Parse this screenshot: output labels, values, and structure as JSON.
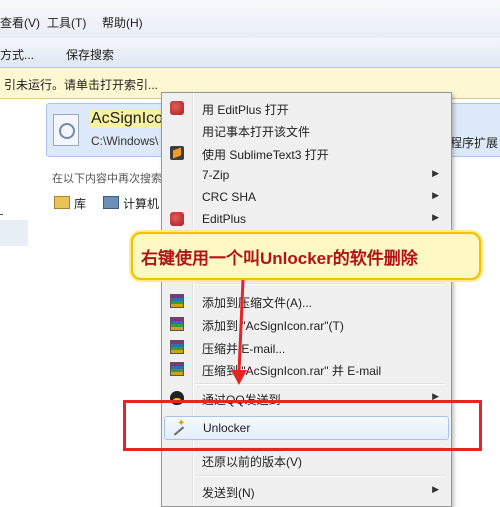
{
  "menubar": {
    "items": [
      "查看(V)",
      "工具(T)",
      "帮助(H)"
    ]
  },
  "toolbar": {
    "items": [
      "方式...",
      "保存搜索"
    ]
  },
  "infobar": {
    "text": "引未运行。请单击打开索引..."
  },
  "search_result": {
    "name": "AcSignIcon",
    "path": "C:\\Windows\\",
    "extra": "程序扩展"
  },
  "search_again": {
    "label": "在以下内容中再次搜索:",
    "locations": [
      "库",
      "计算机"
    ]
  },
  "context_menu": {
    "items": [
      {
        "label": "用 EditPlus 打开",
        "icon": "editplus-icon",
        "submenu": false
      },
      {
        "label": "用记事本打开该文件",
        "icon": "",
        "submenu": false
      },
      {
        "label": "使用 SublimeText3 打开",
        "icon": "sublime-icon",
        "submenu": false
      },
      {
        "label": "7-Zip",
        "icon": "",
        "submenu": true
      },
      {
        "label": "CRC SHA",
        "icon": "",
        "submenu": true
      },
      {
        "label": "EditPlus",
        "icon": "editplus-icon",
        "submenu": true
      },
      {
        "label": "添加到压缩文件(A)...",
        "icon": "winrar-icon",
        "submenu": false
      },
      {
        "label": "添加到 \"AcSignIcon.rar\"(T)",
        "icon": "winrar-icon",
        "submenu": false
      },
      {
        "label": "压缩并 E-mail...",
        "icon": "winrar-icon",
        "submenu": false
      },
      {
        "label": "压缩到 \"AcSignIcon.rar\" 并 E-mail",
        "icon": "winrar-icon",
        "submenu": false
      },
      {
        "label": "通过QQ发送到",
        "icon": "qq-icon",
        "submenu": true
      },
      {
        "label": "Unlocker",
        "icon": "unlocker-wand-icon",
        "submenu": false,
        "highlighted": true
      },
      {
        "label": "还原以前的版本(V)",
        "icon": "",
        "submenu": false
      },
      {
        "label": "发送到(N)",
        "icon": "",
        "submenu": true
      }
    ]
  },
  "annotation": {
    "callout_text": "右键使用一个叫Unlocker的软件删除",
    "highlight_color": "#e52525",
    "callout_border_color": "#f2c200"
  }
}
